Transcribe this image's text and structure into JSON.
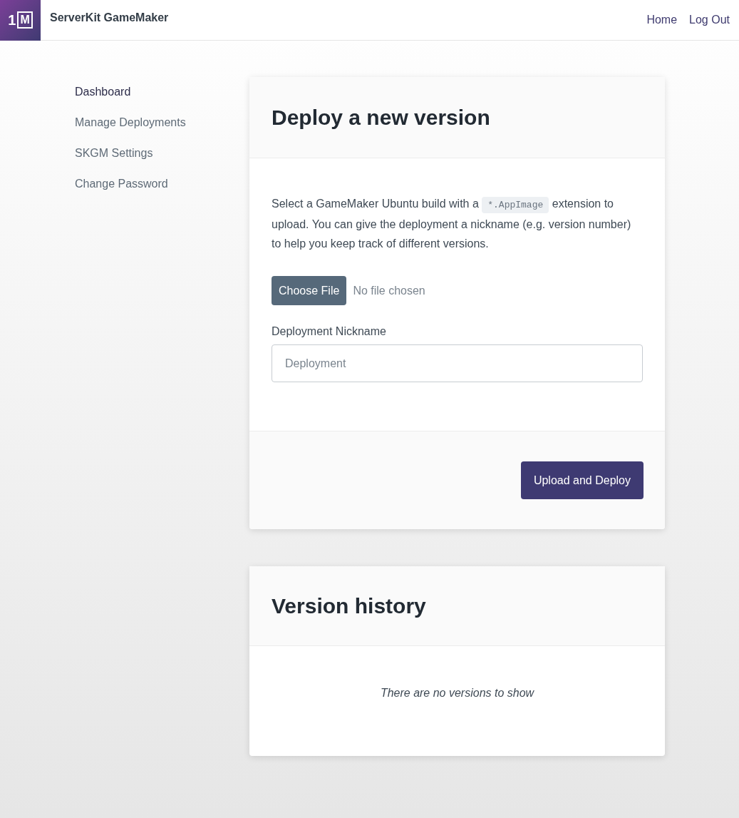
{
  "header": {
    "logo": {
      "digit": "1",
      "letter": "M"
    },
    "title": "ServerKit GameMaker",
    "nav": [
      "Home",
      "Log Out"
    ]
  },
  "sidebar": {
    "items": [
      {
        "label": "Dashboard",
        "selected": true
      },
      {
        "label": "Manage Deployments",
        "selected": false
      },
      {
        "label": "SKGM Settings",
        "selected": false
      },
      {
        "label": "Change Password",
        "selected": false
      }
    ]
  },
  "deploy_card": {
    "title": "Deploy a new version",
    "description": {
      "before": "Select a GameMaker Ubuntu build with a",
      "code": "*.AppImage",
      "after": "extension to upload. You can give the deployment a nickname (e.g. version number) to help you keep track of different versions."
    },
    "file_button": "Choose File",
    "file_status": "No file chosen",
    "nickname_label": "Deployment Nickname",
    "nickname_placeholder": "Deployment",
    "submit": "Upload and Deploy"
  },
  "history_card": {
    "title": "Version history",
    "empty_message": "There are no versions to show"
  }
}
